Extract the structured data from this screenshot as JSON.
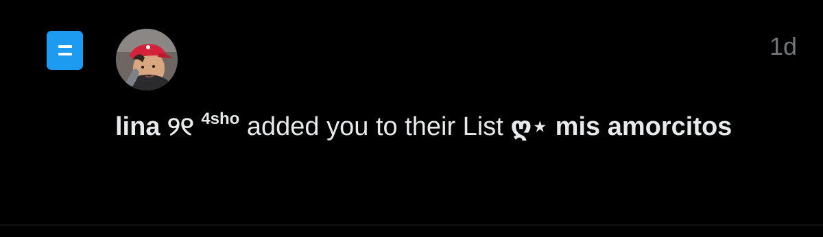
{
  "notification": {
    "timestamp": "1d",
    "user_name": "lina ୨୧",
    "user_superscript": "4sho",
    "action_text": " added you to their List ",
    "list_name": "ღ⋆ mis amorcitos",
    "icon": "list-icon",
    "avatar_icon": "user-avatar-icon"
  },
  "colors": {
    "background": "#000000",
    "accent": "#1d9bf0",
    "text": "#e7e9ea",
    "muted": "#71767b",
    "divider": "#2f3336"
  }
}
